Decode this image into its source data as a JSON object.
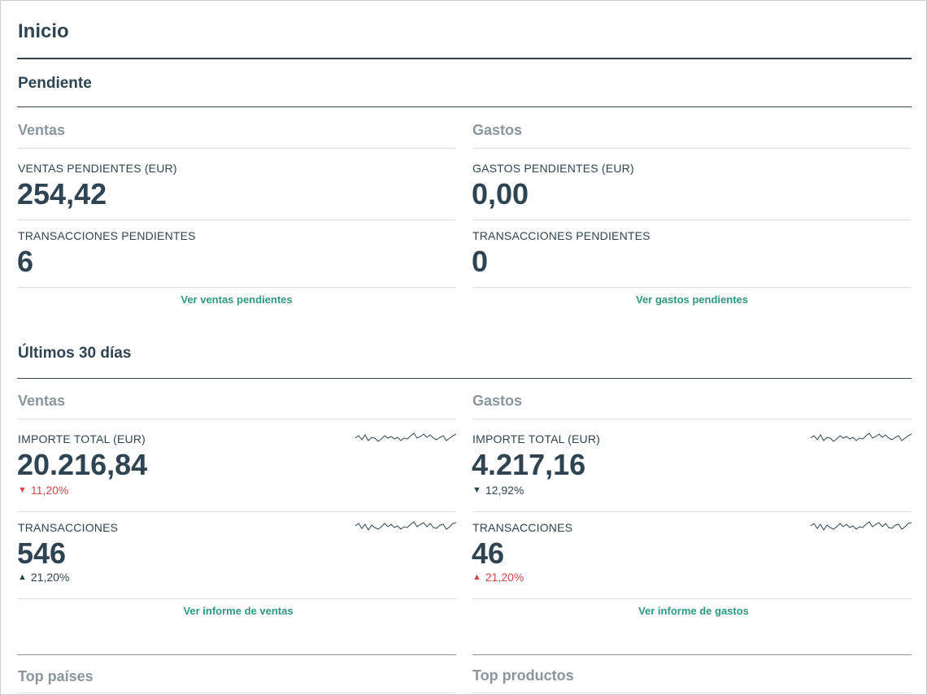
{
  "page": {
    "title": "Inicio"
  },
  "pending": {
    "title": "Pendiente",
    "sales": {
      "title": "Ventas",
      "amount_label": "VENTAS PENDIENTES (EUR)",
      "amount_value": "254,42",
      "transactions_label": "TRANSACCIONES PENDIENTES",
      "transactions_value": "6",
      "link": "Ver ventas pendientes"
    },
    "expenses": {
      "title": "Gastos",
      "amount_label": "GASTOS PENDIENTES (EUR)",
      "amount_value": "0,00",
      "transactions_label": "TRANSACCIONES PENDIENTES",
      "transactions_value": "0",
      "link": "Ver gastos pendientes"
    }
  },
  "last30": {
    "title": "Últimos 30 días",
    "sales": {
      "title": "Ventas",
      "amount_label": "IMPORTE TOTAL (EUR)",
      "amount_value": "20.216,84",
      "amount_delta": "11,20%",
      "amount_delta_direction": "down",
      "amount_delta_color": "#d64545",
      "transactions_label": "TRANSACCIONES",
      "transactions_value": "546",
      "transactions_delta": "21,20%",
      "transactions_delta_direction": "up",
      "transactions_delta_color": "#2f4452",
      "link": "Ver informe de ventas"
    },
    "expenses": {
      "title": "Gastos",
      "amount_label": "IMPORTE TOTAL (EUR)",
      "amount_value": "4.217,16",
      "amount_delta": "12,92%",
      "amount_delta_direction": "down",
      "amount_delta_color": "#2f4452",
      "transactions_label": "TRANSACCIONES",
      "transactions_value": "46",
      "transactions_delta": "21,20%",
      "transactions_delta_direction": "up",
      "transactions_delta_color": "#d64545",
      "link": "Ver informe de gastos"
    }
  },
  "top": {
    "countries_title": "Top países",
    "products_title": "Top productos"
  },
  "glyphs": {
    "triangle_down": "▼",
    "triangle_up": "▲"
  },
  "colors": {
    "primary_text": "#2f4452",
    "muted_text": "#8a969e",
    "link": "#2c9a7f",
    "negative": "#d64545"
  }
}
